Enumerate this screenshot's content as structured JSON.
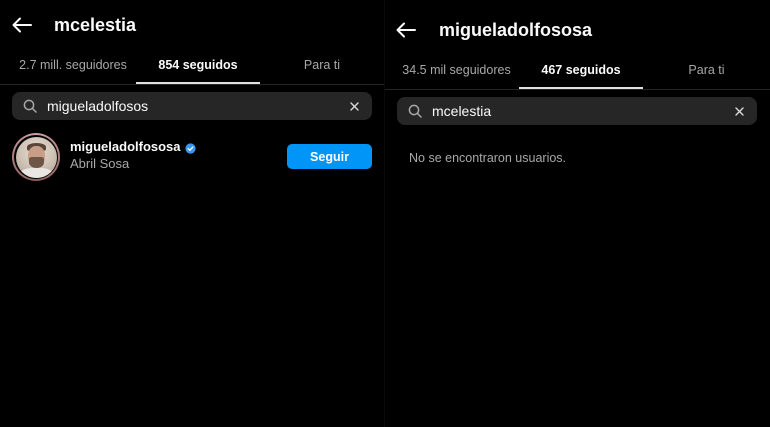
{
  "left_panel": {
    "header": {
      "title": "mcelestia",
      "back_icon": "arrow-left-icon"
    },
    "tabs": [
      {
        "label": "2.7 mill. seguidores",
        "active": false
      },
      {
        "label": "854 seguidos",
        "active": true
      },
      {
        "label": "Para ti",
        "active": false
      }
    ],
    "search": {
      "value": "migueladolfosos",
      "search_icon": "search-icon",
      "clear_icon": "close-icon"
    },
    "results": [
      {
        "username": "migueladolfososa",
        "verified": true,
        "full_name": "Abril Sosa",
        "follow_label": "Seguir"
      }
    ]
  },
  "right_panel": {
    "header": {
      "title": "migueladolfososa",
      "back_icon": "arrow-left-icon"
    },
    "tabs": [
      {
        "label": "34.5 mil seguidores",
        "active": false
      },
      {
        "label": "467 seguidos",
        "active": true
      },
      {
        "label": "Para ti",
        "active": false
      }
    ],
    "search": {
      "value": "mcelestia",
      "search_icon": "search-icon",
      "clear_icon": "close-icon"
    },
    "empty_message": "No se encontraron usuarios."
  },
  "colors": {
    "background": "#000000",
    "search_bg": "#262626",
    "secondary_text": "#a8a8a8",
    "follow_button": "#0095f6",
    "verified_badge": "#3897f0"
  }
}
